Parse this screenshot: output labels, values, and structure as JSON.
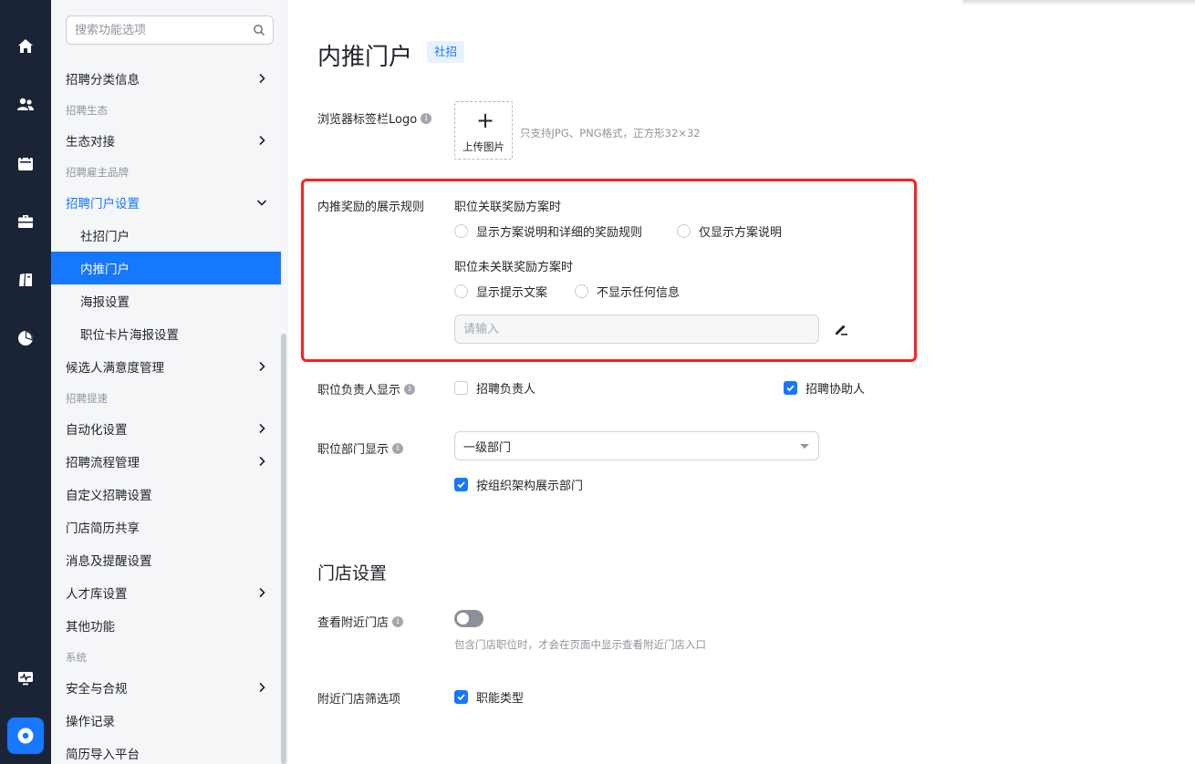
{
  "sidebar": {
    "search_placeholder": "搜索功能选项",
    "groups": {
      "eco": "招聘生态",
      "brand": "招聘雇主品牌",
      "speed": "招聘提速",
      "system": "系统"
    },
    "items": {
      "category": "招聘分类信息",
      "eco_dock": "生态对接",
      "portal_settings": "招聘门户设置",
      "social_portal": "社招门户",
      "referral_portal": "内推门户",
      "poster": "海报设置",
      "job_card_poster": "职位卡片海报设置",
      "candidate_satisfaction": "候选人满意度管理",
      "automation": "自动化设置",
      "process": "招聘流程管理",
      "custom": "自定义招聘设置",
      "store_resume": "门店简历共享",
      "notifications": "消息及提醒设置",
      "talent_pool": "人才库设置",
      "other": "其他功能",
      "security": "安全与合规",
      "operation_log": "操作记录",
      "resume_import": "简历导入平台"
    }
  },
  "page": {
    "title": "内推门户",
    "badge": "社招"
  },
  "form": {
    "logo_label": "浏览器标签栏Logo",
    "upload_label": "上传图片",
    "upload_hint": "只支持JPG、PNG格式，正方形32×32",
    "reward_rule_label": "内推奖励的展示规则",
    "linked_heading": "职位关联奖励方案时",
    "linked_opt1": "显示方案说明和详细的奖励规则",
    "linked_opt2": "仅显示方案说明",
    "unlinked_heading": "职位未关联奖励方案时",
    "unlinked_opt1": "显示提示文案",
    "unlinked_opt2": "不显示任何信息",
    "tip_placeholder": "请输入",
    "owner_label": "职位负责人显示",
    "owner_opt1": "招聘负责人",
    "owner_opt2": "招聘协助人",
    "dept_label": "职位部门显示",
    "dept_value": "一级部门",
    "dept_org_check": "按组织架构展示部门"
  },
  "store": {
    "section_title": "门店设置",
    "nearby_label": "查看附近门店",
    "nearby_hint": "包含门店职位时，才会在页面中显示查看附近门店入口",
    "filter_label": "附近门店筛选项",
    "filter_opt1": "职能类型"
  },
  "state": {
    "linked_opt1_selected": false,
    "linked_opt2_selected": false,
    "unlinked_opt1_selected": false,
    "unlinked_opt2_selected": false,
    "owner_opt1_checked": false,
    "owner_opt2_checked": true,
    "dept_org_checked": true,
    "nearby_enabled": false,
    "filter_opt1_checked": true
  },
  "colors": {
    "accent": "#1677ff",
    "rail": "#1b2437",
    "highlight_border": "#ff1e1e"
  },
  "icons": {
    "rail": [
      "home-icon",
      "users-icon",
      "calendar-icon",
      "briefcase-icon",
      "book-icon",
      "pie-chart-icon",
      "monitor-pulse-icon",
      "settings-icon"
    ]
  }
}
